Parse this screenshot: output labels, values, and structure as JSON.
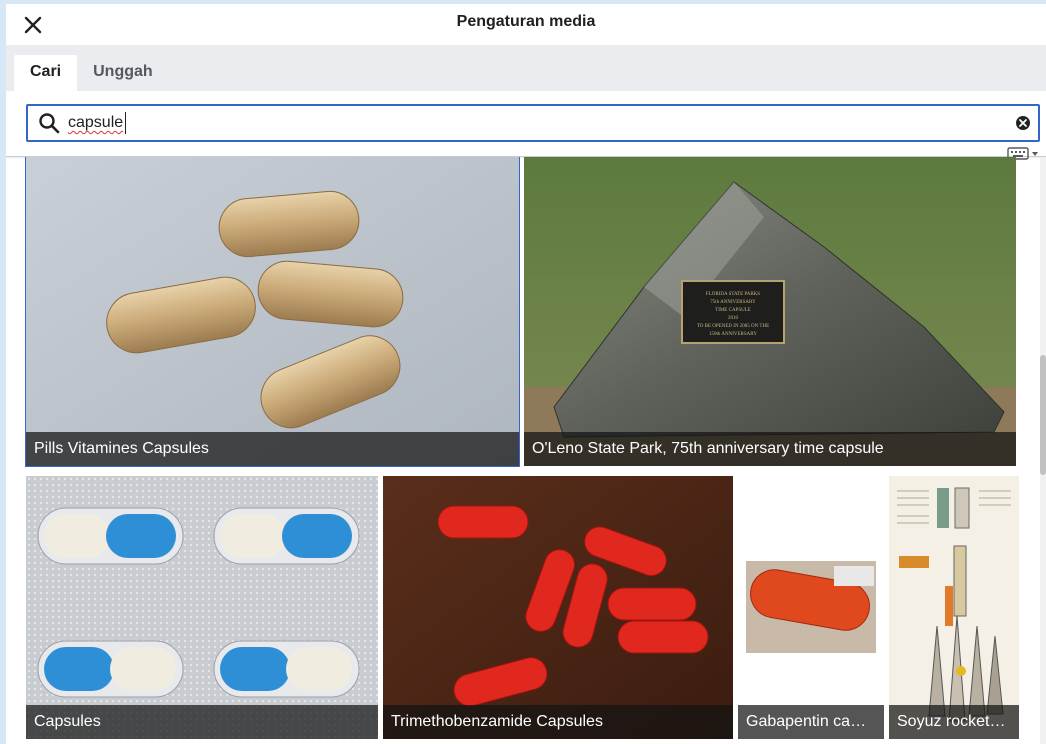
{
  "dialog": {
    "title": "Pengaturan media",
    "close_icon": "close-icon"
  },
  "tabs": [
    {
      "label": "Cari",
      "active": true
    },
    {
      "label": "Unggah",
      "active": false
    }
  ],
  "search": {
    "value": "capsule",
    "search_icon": "search-icon",
    "clear_icon": "clear-circle-icon",
    "keyboard_icon": "keyboard-icon"
  },
  "results": [
    {
      "caption": "Pills Vitamines Capsules",
      "selected": true
    },
    {
      "caption": "O'Leno State Park, 75th anniversary time capsule",
      "selected": false
    },
    {
      "caption": "Capsules",
      "selected": false
    },
    {
      "caption": "Trimethobenzamide Capsules",
      "selected": false
    },
    {
      "caption": "Gabapentin ca…",
      "selected": false
    },
    {
      "caption": "Soyuz rocket…",
      "selected": false
    }
  ],
  "plaque_text": [
    "FLORIDA STATE PARKS",
    "75th ANNIVERSARY",
    "TIME CAPSULE",
    "2010",
    "TO BE OPENED IN 2085 ON THE",
    "150th ANNIVERSARY"
  ],
  "colors": {
    "accent": "#3366cc",
    "caption_bg": "rgba(20,20,20,0.72)",
    "tab_bar": "#eaecf0"
  }
}
